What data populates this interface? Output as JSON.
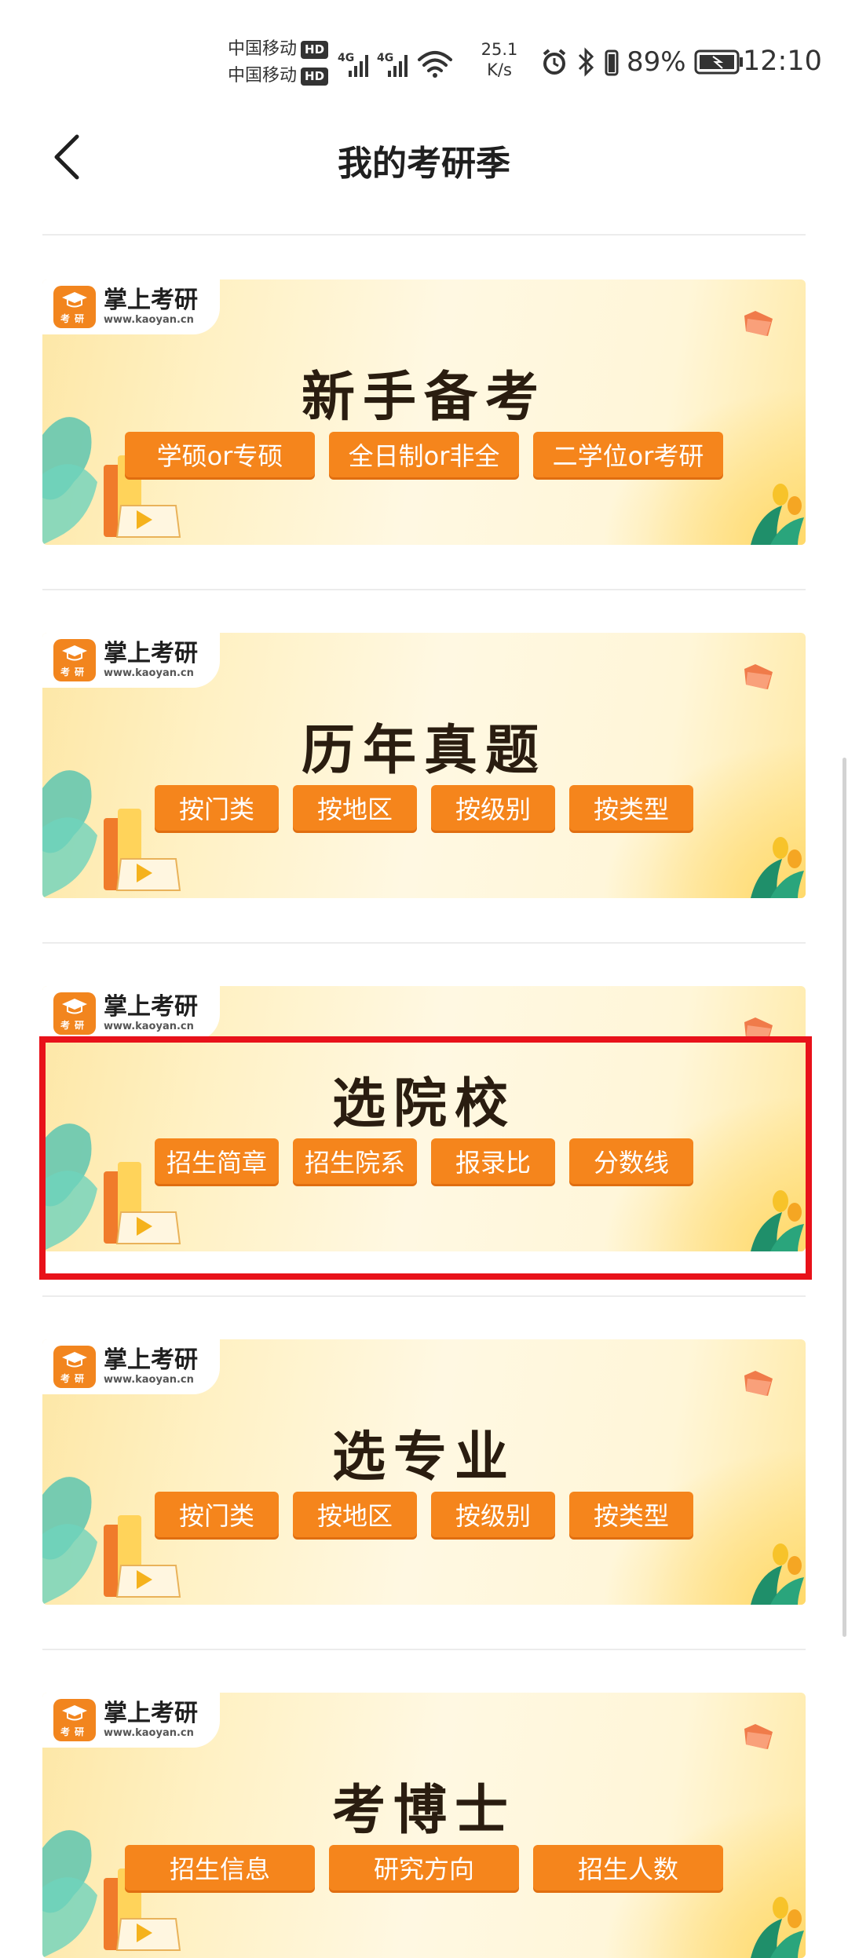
{
  "status_bar": {
    "carrier_1": "中国移动",
    "carrier_2": "中国移动",
    "hd_label": "HD",
    "network_type": "4G",
    "net_speed_value": "25.1",
    "net_speed_unit": "K/s",
    "battery_percent": "89%",
    "time": "12:10"
  },
  "header": {
    "title": "我的考研季",
    "back_icon": "chevron-left-icon"
  },
  "logo": {
    "name": "掌上考研",
    "url": "www.kaoyan.cn",
    "mark_label": "考研"
  },
  "banners": [
    {
      "title": "新手备考",
      "buttons": [
        "学硕or专硕",
        "全日制or非全",
        "二学位or考研"
      ]
    },
    {
      "title": "历年真题",
      "buttons": [
        "按门类",
        "按地区",
        "按级别",
        "按类型"
      ]
    },
    {
      "title": "选院校",
      "buttons": [
        "招生简章",
        "招生院系",
        "报录比",
        "分数线"
      ]
    },
    {
      "title": "选专业",
      "buttons": [
        "按门类",
        "按地区",
        "按级别",
        "按类型"
      ]
    },
    {
      "title": "考博士",
      "buttons": [
        "招生信息",
        "研究方向",
        "招生人数"
      ]
    }
  ],
  "colors": {
    "accent_orange": "#f5851c",
    "highlight_red": "#e8121a",
    "title_dark": "#2a1d10"
  }
}
